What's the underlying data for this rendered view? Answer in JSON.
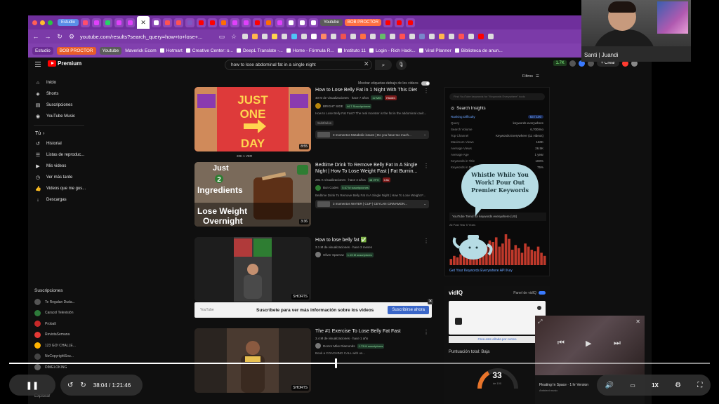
{
  "browser": {
    "tabs_left": [
      "Estudio"
    ],
    "tabs_right": [
      "Youtube",
      "BOB PROCTOR"
    ],
    "url": "youtube.com/results?search_query=how+to+lose+...",
    "bookmarks_pills": [
      "Estudio",
      "BOB PROCTOR",
      "Youtube"
    ],
    "bookmarks": [
      "Maverick Ecom",
      "Hotmart",
      "Creative Center: o...",
      "DeepL Translate -...",
      "Home - Fórmula R...",
      "Instituto 11",
      "Login - Rich Hack...",
      "Viral Planner",
      "Biblioteca de anun..."
    ],
    "accent": "#7b3aa8"
  },
  "youtube": {
    "logo_text": "Premium",
    "search_query": "how to lose abdominal fat in a single night",
    "header_right": {
      "count": "1.7K",
      "create": "+ Crear"
    },
    "sidebar_main": [
      {
        "icon": "home-icon",
        "label": "Inicio"
      },
      {
        "icon": "shorts-icon",
        "label": "Shorts"
      },
      {
        "icon": "subscriptions-icon",
        "label": "Suscripciones"
      },
      {
        "icon": "music-icon",
        "label": "YouTube Music"
      }
    ],
    "sidebar_you_label": "Tú",
    "sidebar_you": [
      {
        "icon": "history-icon",
        "label": "Historial"
      },
      {
        "icon": "playlist-icon",
        "label": "Listas de reproduc..."
      },
      {
        "icon": "my-videos-icon",
        "label": "Mis videos"
      },
      {
        "icon": "clock-icon",
        "label": "Ver más tarde"
      },
      {
        "icon": "like-icon",
        "label": "Videos que me gus..."
      },
      {
        "icon": "download-icon",
        "label": "Descargas"
      }
    ],
    "subscriptions_label": "Suscripciones",
    "subscriptions": [
      "Te Regalan Duda...",
      "Caracol Televisión",
      "Probalt",
      "RevistaSemana",
      "123 GO! CHALLE...",
      "NoCopyrightSou...",
      "DIMELOKING"
    ],
    "explorar": "Explorar",
    "filter_label": "Mostrar etiquetas debajo de los videos",
    "filters_btn": "Filtros",
    "results": [
      {
        "title": "How to Lose Belly Fat in 1 Night With This Diet",
        "meta": "40 M de visualizaciones · hace 7 años",
        "channel": "BRIGHT SIDE",
        "channel_badge": "44.7 Suscripciones",
        "tag": "12 MIN",
        "tag2": "Hidden",
        "desc": "How to Lose Belly Fat Fast? The real monster is the fat in the abdominal cavit...",
        "chip": "Subtítulos",
        "moments": "3 momentos  Metabolic issues | Do you have too much...",
        "thumb_text": [
          "JUST",
          "ONE",
          "DAY"
        ],
        "duration": "8:55",
        "views_bar": "20K 1 VER"
      },
      {
        "title": "Bedtime Drink To Remove Belly Fat In A Single Night | How To Lose Weight Fast | Fat Burnin...",
        "meta": "291 K visualizaciones · hace 4 años",
        "channel": "Bon Codes",
        "channel_badge": "5.67 M suscripciones",
        "tag": "48 VPH",
        "tag2": "0.5x",
        "desc": "Bedtime Drink To Remove Belly Fat In A Single Night | How To Lose Weight F...",
        "moments": "3 momentos  WATER | CUP | CEYLAN CINNAMON...",
        "thumb_text": [
          "Just",
          "2",
          "Ingredients",
          "Lose Weight",
          "Overnight"
        ],
        "duration": "3:36"
      },
      {
        "title": "How to lose belly fat ✅",
        "meta": "3.1 M de visualizaciones · hace 3 meses",
        "channel": "Oliver Sparrow",
        "channel_badge": "1.15 M suscriptores",
        "duration": "SHORTS"
      },
      {
        "title": "The #1 Exercise To Lose Belly Fat Fast",
        "meta": "3.4 M de visualizaciones · hace 1 año",
        "channel": "Doctor Mike Diamonds",
        "channel_badge": "1.73 M suscriptores",
        "desc": "Book a COACHING CALL with us...",
        "duration": "SHORTS"
      }
    ],
    "banner": {
      "left": "YouTube",
      "text": "Suscríbete para ver más información sobre los videos",
      "button": "Suscribirse ahora"
    }
  },
  "insights": {
    "search_placeholder": "Find YouTube keywords for \"Keywords Everywhere\" tools",
    "title": "Search Insights",
    "rows": [
      {
        "k": "Ranking Difficulty",
        "v": "83 / 100"
      },
      {
        "k": "Query",
        "v": "keywords everywhere"
      },
      {
        "k": "Search Volume",
        "v": "6,700/mo"
      },
      {
        "k": "Top Channel",
        "v": "Keywords Everywhere  (11 videos)"
      },
      {
        "k": "Maximum Views",
        "v": "160K"
      },
      {
        "k": "Average Views",
        "v": "26.5K"
      },
      {
        "k": "Average Age",
        "v": "1 year"
      },
      {
        "k": "Keywords in Title",
        "v": "100%"
      },
      {
        "k": "Keywords in Desc",
        "v": "75%"
      }
    ],
    "trend_title": "YouTube Trend for keywords everywhere (US)",
    "trend_sub": "All    Past Year    5 Years",
    "trend_bars": [
      0.2,
      0.3,
      0.25,
      0.35,
      0.3,
      0.4,
      0.5,
      0.45,
      0.6,
      0.55,
      0.7,
      0.65,
      0.8,
      0.75,
      0.9,
      0.6,
      0.7,
      1.0,
      0.85,
      0.5,
      0.65,
      0.55,
      0.4,
      0.7,
      0.6,
      0.5,
      0.45,
      0.6,
      0.4,
      0.3
    ],
    "get_key": "Get Your Keywords Everywhere API Key",
    "bubble": "Whistle While You Work! Pour Out Premier Keywords"
  },
  "vidiq": {
    "logo": "vidIQ",
    "panel_label": "Panel de vidIQ",
    "link": "Crea este añada por correo",
    "score_label": "Puntuación total: Baja",
    "score": "33",
    "score_sub": "de 100",
    "score_fraction": 0.33
  },
  "miniplayer": {
    "title": "Floating In Space · 1 hr Version",
    "sub": "Ambient music"
  },
  "webcam": {
    "label": "Santi | Juandi"
  },
  "player": {
    "time": "38:04 / 1:21:46",
    "speed": "1X",
    "progress": 0.466
  }
}
